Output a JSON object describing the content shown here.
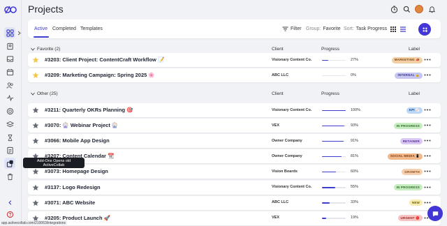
{
  "app": {
    "title": "Projects"
  },
  "tabs": [
    {
      "label": "Active"
    },
    {
      "label": "Completed"
    },
    {
      "label": "Templates"
    }
  ],
  "toolbar": {
    "filter_label": "Filter",
    "group_prefix": "Group:",
    "group_value": "Favorite",
    "sort_prefix": "Sort:",
    "sort_value": "Task Progress"
  },
  "groups": [
    {
      "title": "Favorite (2)",
      "col_client": "Client",
      "col_progress": "Progress",
      "col_label": "Label",
      "rows": [
        {
          "name": "#3203: Client Project: ContentCraft Workflow 📝",
          "client": "Visionary Content Co.",
          "progress": 27,
          "progress_text": "27%",
          "label": "MARKETING 📣",
          "label_bg": "#f4cfa4",
          "label_fg": "#7a4a14",
          "favorite": true
        },
        {
          "name": "#3209: Marketing Campaign: Spring 2025 🌸",
          "client": "ABC LLC",
          "progress": 0,
          "progress_text": "0%",
          "label": "INTERNAL 🔒",
          "label_bg": "#c7c6f3",
          "label_fg": "#3a3a8a",
          "favorite": true
        }
      ]
    },
    {
      "title": "Other (25)",
      "col_client": "Client",
      "col_progress": "Progress",
      "col_label": "Label",
      "rows": [
        {
          "name": "#3211: Quarterly OKRs Planning 🎯",
          "client": "Visionary Content Co.",
          "progress": 100,
          "progress_text": "100%",
          "label": "KPI 📈",
          "label_bg": "#bcd6f6",
          "label_fg": "#1e4f8c",
          "favorite": false
        },
        {
          "name": "#3070: 🎡 Webinar Project 🎡",
          "client": "VEX",
          "progress": 93,
          "progress_text": "93%",
          "label": "IN PROGRESS",
          "label_bg": "#c8ecc2",
          "label_fg": "#2d6b24",
          "favorite": false
        },
        {
          "name": "#3066: Mobile App Design",
          "client": "Owner Company",
          "progress": 91,
          "progress_text": "91%",
          "label": "RETAINER",
          "label_bg": "#d9c8f4",
          "label_fg": "#5b2f9a",
          "favorite": false
        },
        {
          "name": "#3207: Content Calendar 📆",
          "client": "Owner Company",
          "progress": 81,
          "progress_text": "81%",
          "label": "SOCIAL MEDIA 📱",
          "label_bg": "#f2b88a",
          "label_fg": "#7a3b10",
          "favorite": false
        },
        {
          "name": "#3073: Homepage Design",
          "client": "Vision Boards",
          "progress": 60,
          "progress_text": "60%",
          "label": "GROWTH",
          "label_bg": "#f6cfae",
          "label_fg": "#8a4a14",
          "favorite": false
        },
        {
          "name": "#3137: Logo Redesign",
          "client": "Visionary Content Co.",
          "progress": 55,
          "progress_text": "55%",
          "label": "IN PROGRESS",
          "label_bg": "#c8ecc2",
          "label_fg": "#2d6b24",
          "favorite": false
        },
        {
          "name": "#3071: ABC Website",
          "client": "ABC LLC",
          "progress": 33,
          "progress_text": "33%",
          "label": "NEW",
          "label_bg": "#f6ecae",
          "label_fg": "#6e5a10",
          "favorite": false
        },
        {
          "name": "#3205: Product Launch 🚀",
          "client": "VEX",
          "progress": 19,
          "progress_text": "19%",
          "label": "URGENT 🔴",
          "label_bg": "#f7c4c4",
          "label_fg": "#9a2020",
          "favorite": false
        }
      ]
    }
  ],
  "tooltip": {
    "line1": "Add-Ons Opens old",
    "line2": "ActiveCollab"
  },
  "status_url": "app.activecollab.com/210063/integrations",
  "colors": {
    "accent": "#3c3cd1",
    "button": "#4237d6",
    "favorite_star": "#f4c84a",
    "star_inactive": "#666a75"
  },
  "icons": {
    "sidebar": [
      "projects-grid-icon",
      "my-work-icon",
      "inbox-icon",
      "calendar-icon",
      "people-icon",
      "activity-icon",
      "target-icon",
      "layers-icon",
      "time-icon",
      "reports-icon",
      "invoices-icon",
      "add-ons-icon",
      "trash-icon",
      "chevron-icon",
      "help-icon",
      "avatar-icon"
    ],
    "top": [
      "clock-icon",
      "search-icon",
      "avatar",
      "bell-icon"
    ]
  }
}
